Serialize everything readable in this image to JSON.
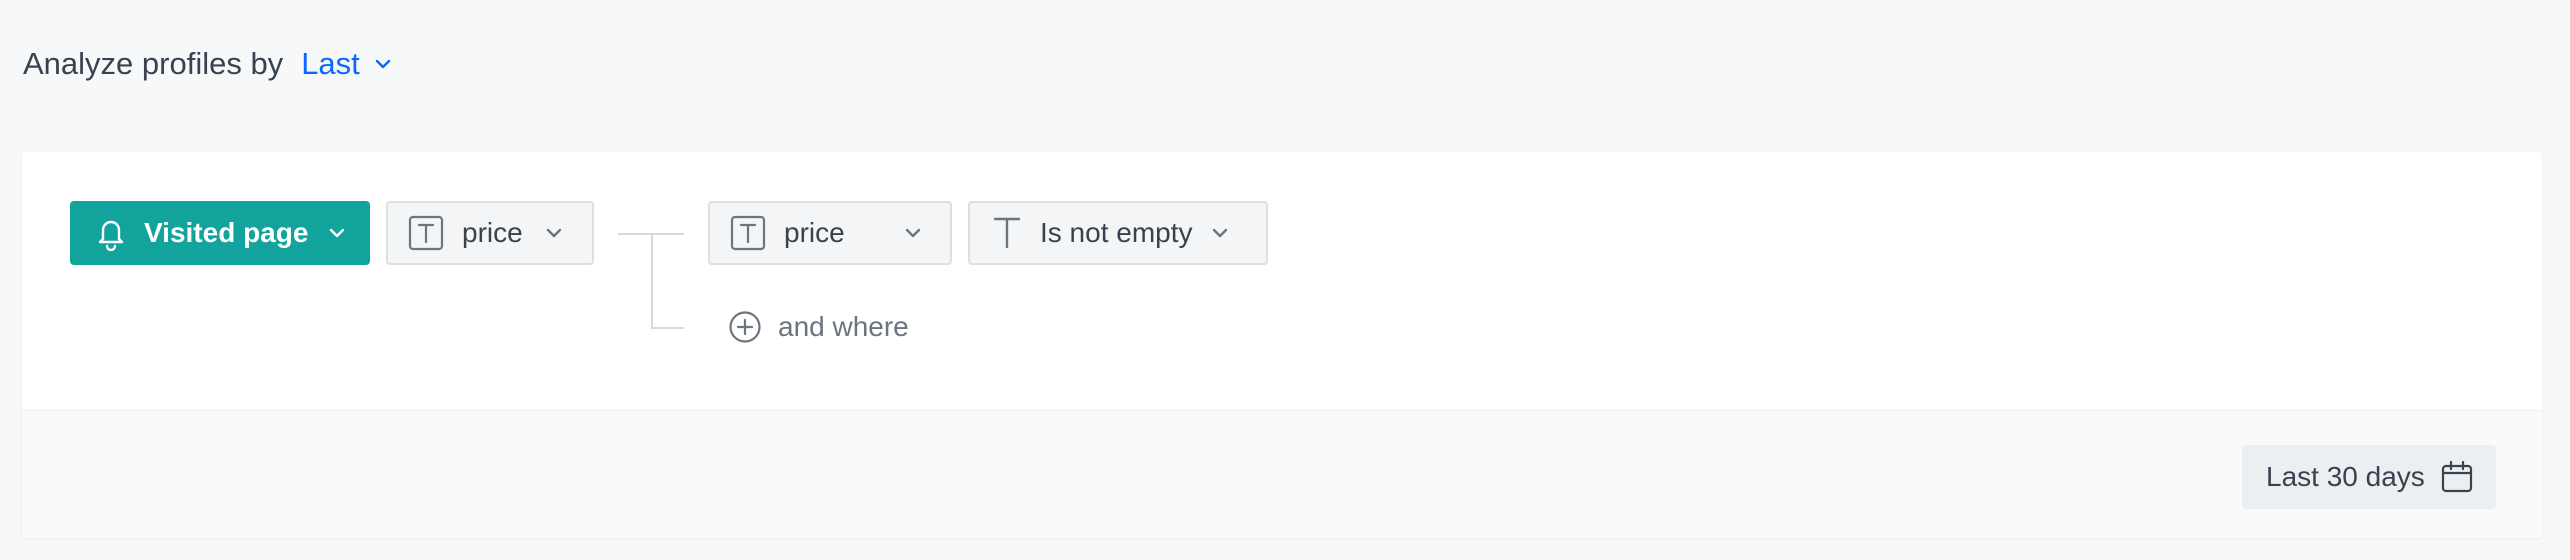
{
  "header": {
    "title": "Analyze profiles by",
    "mode": "Last"
  },
  "filter": {
    "event_button": "Visited page",
    "param_button": "price",
    "sub_param_button": "price",
    "operator_button": "Is not empty",
    "add_where": "and where"
  },
  "footer": {
    "date_range": "Last 30 days"
  },
  "icons": {
    "event": "bell-icon",
    "param": "text-type-icon",
    "operator": "text-t-icon",
    "add": "plus-circle-icon",
    "date": "calendar-icon",
    "dropdown": "chevron-down-icon"
  },
  "colors": {
    "accent": "#13a39d",
    "link": "#0b68ff"
  }
}
